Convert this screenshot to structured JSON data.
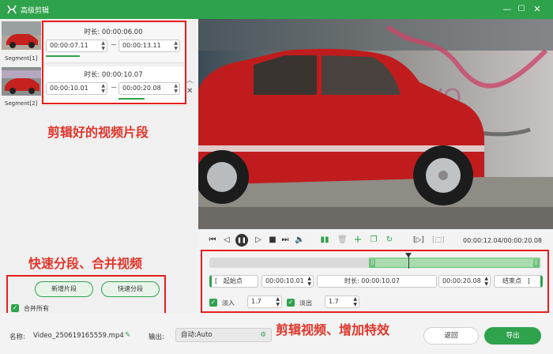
{
  "window": {
    "title": "高级剪辑",
    "minimize": "—",
    "maximize": "☐",
    "close": "✕"
  },
  "segments": [
    {
      "label": "Segment[1]",
      "duration": "时长: 00:00:06.00",
      "start": "00:00:07.11",
      "end": "00:00:13.11",
      "progress": 0.55
    },
    {
      "label": "Segment[2]",
      "duration": "时长: 00:00:10.07",
      "start": "00:00:10.01",
      "end": "00:00:20.08",
      "progress": 0.42
    }
  ],
  "annotations": {
    "clips": "剪辑好的视频片段",
    "split": "快速分段、合并视频",
    "edit": "剪辑视频、增加特效"
  },
  "left_controls": {
    "new_segment": "新增片段",
    "quick_split": "快速分段",
    "merge_all": "合并所有",
    "merge_all_checked": true
  },
  "player": {
    "time": "00:00:12.04/00:00:20.08"
  },
  "editor": {
    "start_point": "起始点",
    "start_value": "00:00:10.01",
    "duration_label": "时长:",
    "duration_value": "00:00:10.07",
    "end_value": "00:00:20.08",
    "end_point": "结束点",
    "fade_in_label": "淡入",
    "fade_in_value": "1.7",
    "fade_in_checked": true,
    "fade_out_label": "淡出",
    "fade_out_value": "1.7",
    "fade_out_checked": true,
    "selection_start": 0.48,
    "selection_end": 1.0,
    "playhead": 0.6
  },
  "footer": {
    "name_label": "名称:",
    "name_value": "Video_250619165559.mp4",
    "output_label": "输出:",
    "output_value": "自动:Auto",
    "back": "返回",
    "export": "导出"
  },
  "colors": {
    "accent": "#2fa24c",
    "annotation": "#e0352b",
    "box": "#e61e1e"
  }
}
